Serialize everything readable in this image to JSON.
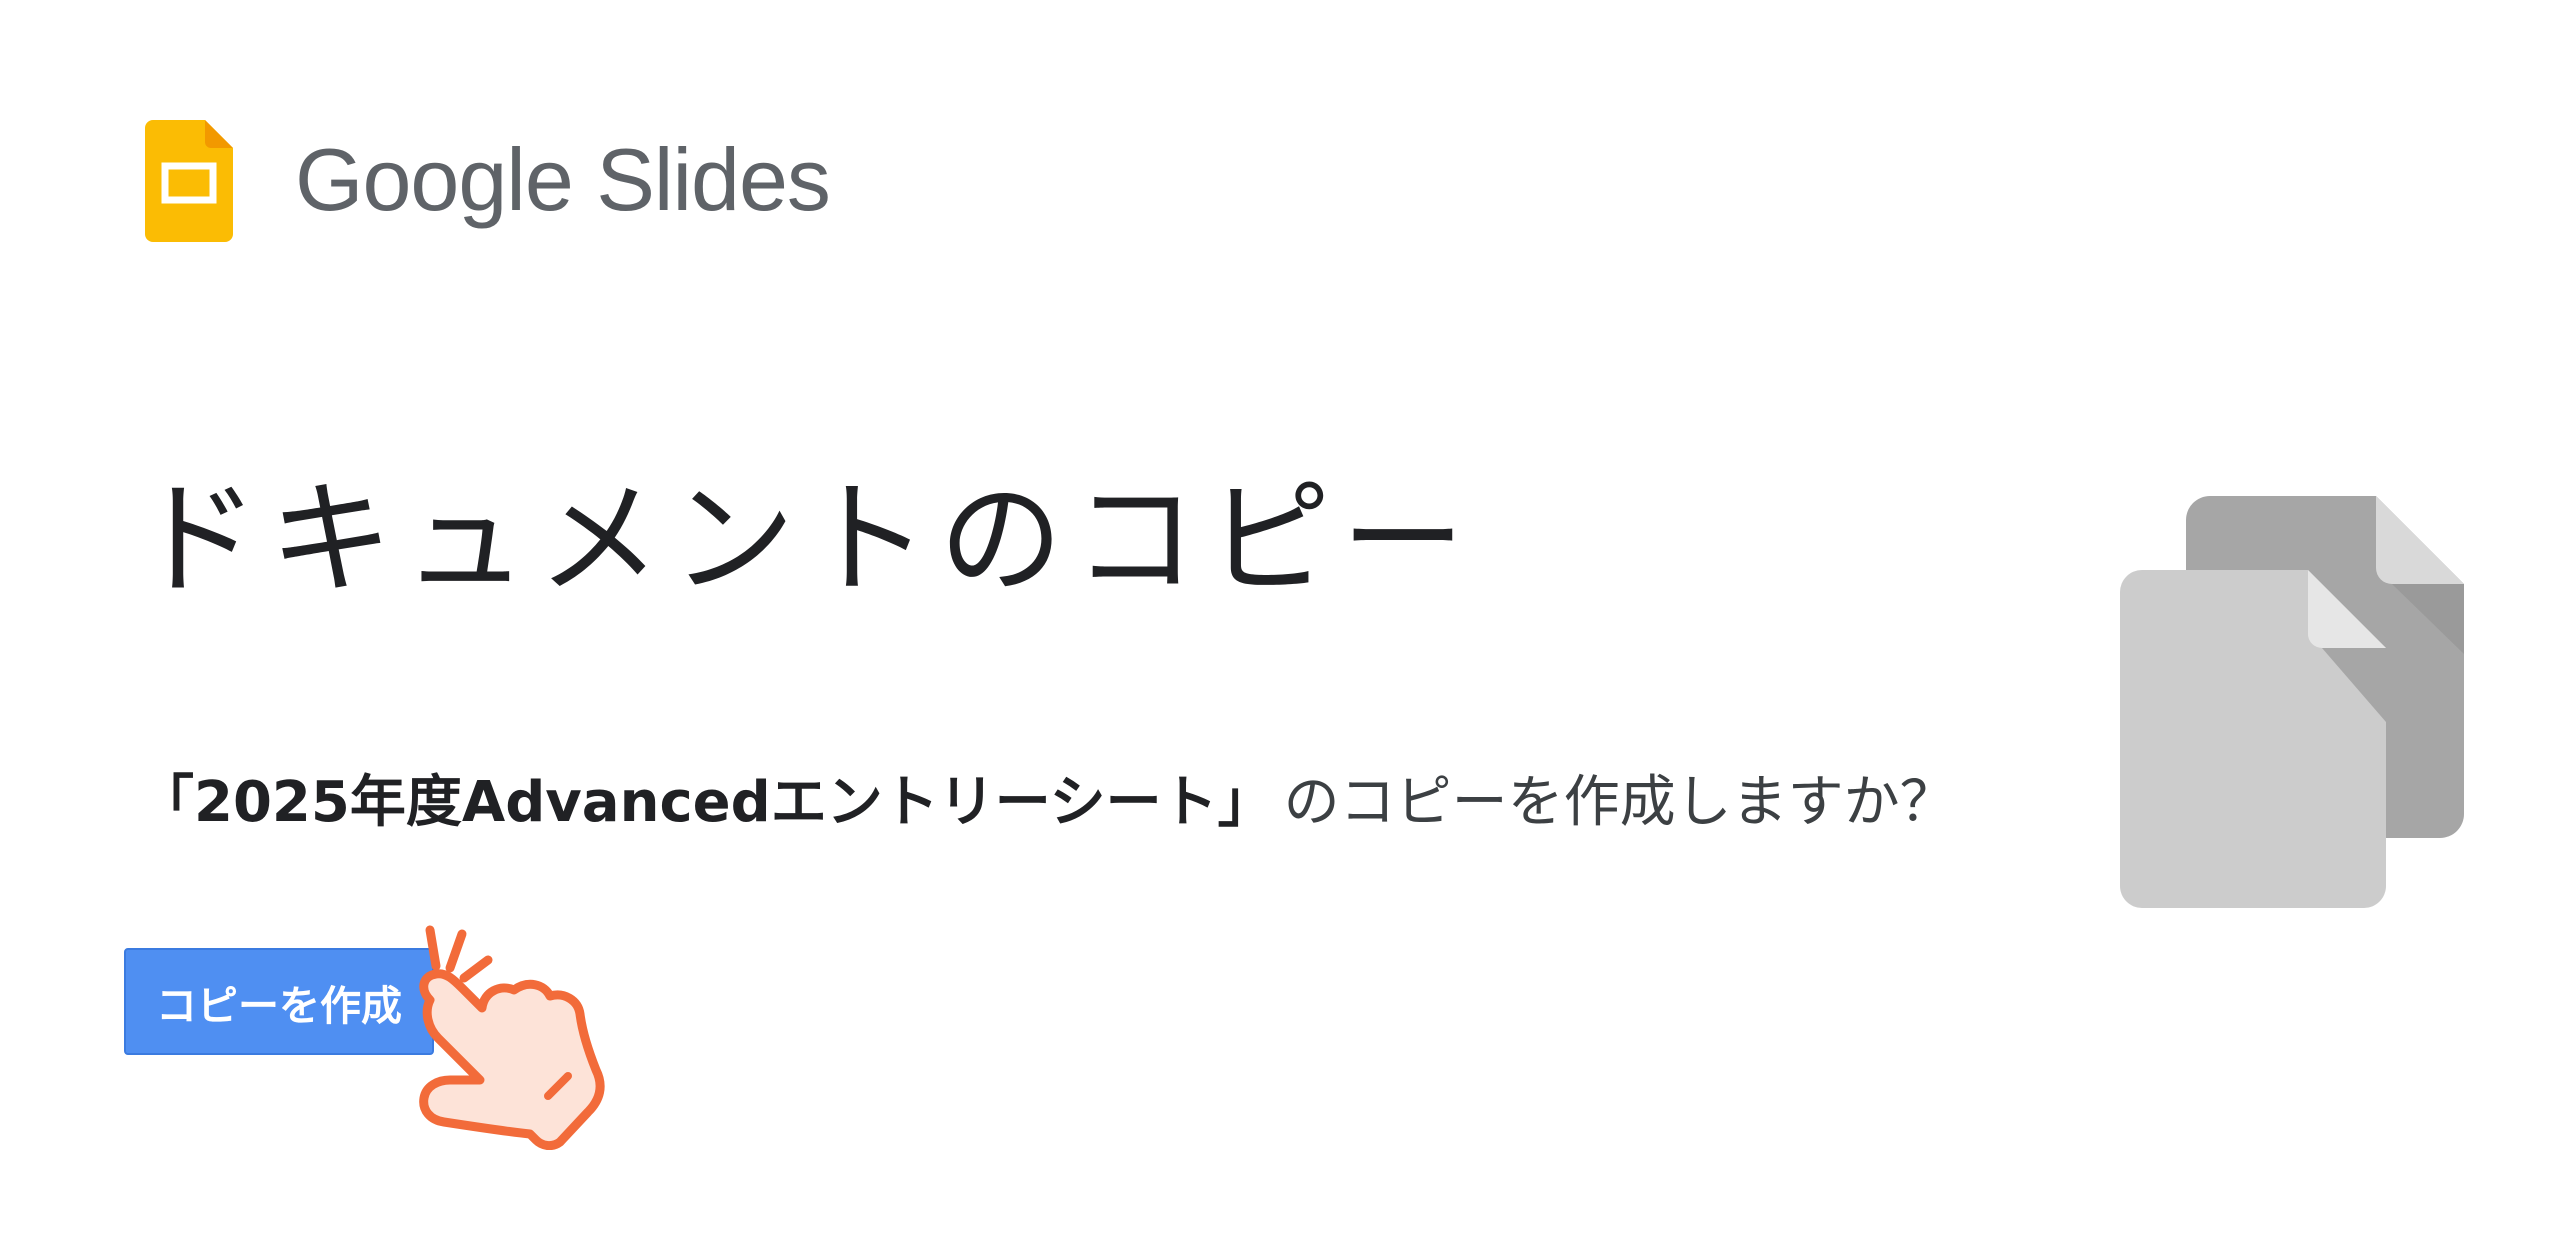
{
  "header": {
    "logo_text": "Google Slides",
    "logo_icon": "google-slides-icon",
    "brand_color": "#FBBC04"
  },
  "main": {
    "title": "ドキュメントのコピー",
    "prompt_doc_name": "「2025年度Advancedエントリーシート」",
    "prompt_rest": "のコピーを作成しますか？",
    "copy_button_label": "コピーを作成",
    "button_color": "#4F8FF2",
    "pointer_icon": "pointing-hand-icon",
    "illustration_icon": "document-copies-icon"
  }
}
